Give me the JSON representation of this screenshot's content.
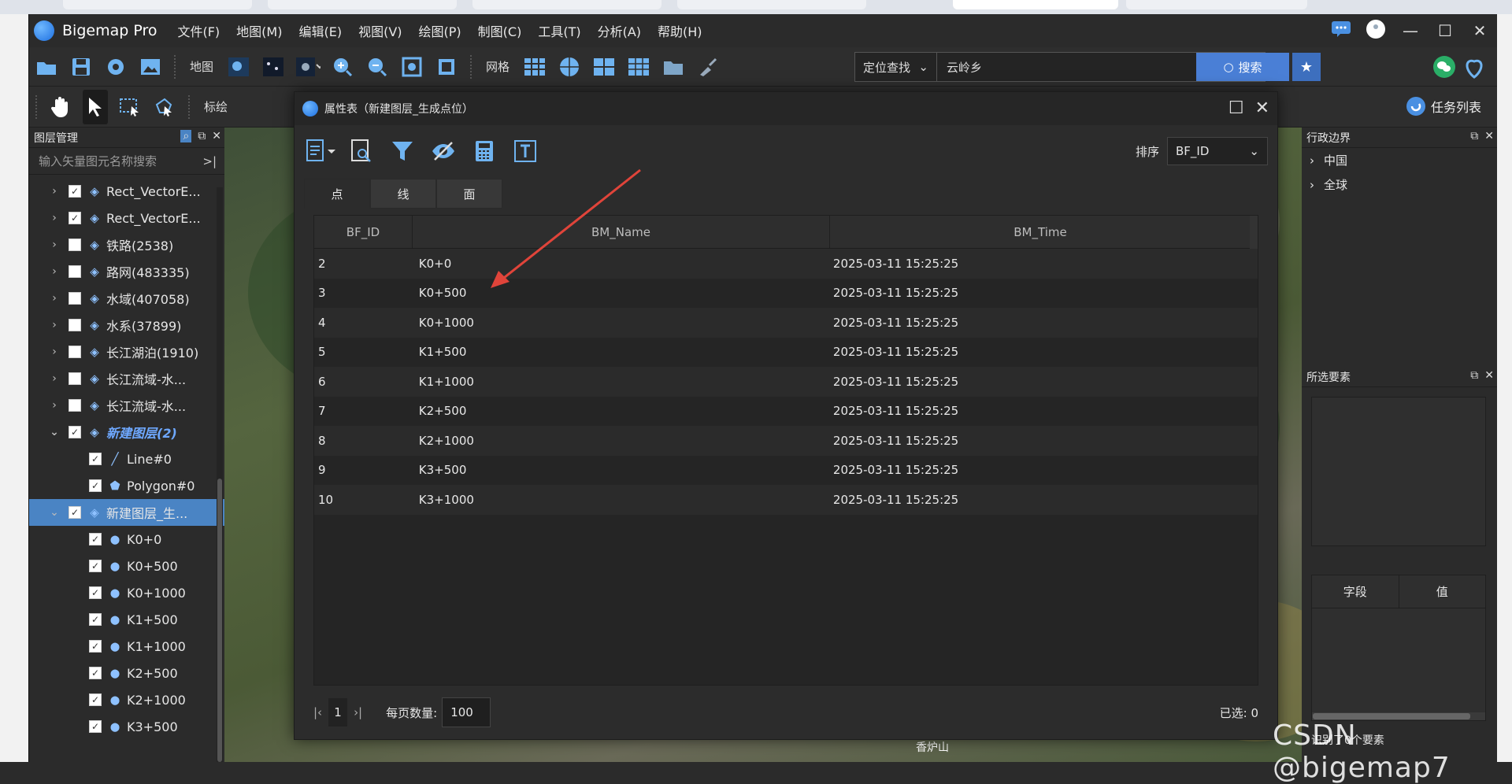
{
  "app": {
    "title": "Bigemap Pro"
  },
  "menu": [
    "文件(F)",
    "地图(M)",
    "编辑(E)",
    "视图(V)",
    "绘图(P)",
    "制图(C)",
    "工具(T)",
    "分析(A)",
    "帮助(H)"
  ],
  "toolbar1": {
    "map_label": "地图",
    "grid_label": "网格",
    "search_mode": "定位查找",
    "search_value": "云岭乡",
    "search_button": "搜索"
  },
  "toolbar2": {
    "annotate_label": "标绘",
    "task_list": "任务列表"
  },
  "left_panel": {
    "title": "图层管理",
    "search_placeholder": "输入矢量图元名称搜索",
    "layers": [
      {
        "label": "Rect_VectorE...",
        "checked": true,
        "expandable": true,
        "style": "normal",
        "indent": 0
      },
      {
        "label": "Rect_VectorE...",
        "checked": true,
        "expandable": true,
        "style": "normal",
        "indent": 0
      },
      {
        "label": "铁路(2538)",
        "checked": false,
        "expandable": true,
        "style": "normal",
        "indent": 0
      },
      {
        "label": "路网(483335)",
        "checked": false,
        "expandable": true,
        "style": "normal",
        "indent": 0
      },
      {
        "label": "水域(407058)",
        "checked": false,
        "expandable": true,
        "style": "normal",
        "indent": 0
      },
      {
        "label": "水系(37899)",
        "checked": false,
        "expandable": true,
        "style": "normal",
        "indent": 0
      },
      {
        "label": "长江湖泊(1910)",
        "checked": false,
        "expandable": true,
        "style": "normal",
        "indent": 0
      },
      {
        "label": "长江流域-水...",
        "checked": false,
        "expandable": true,
        "style": "normal",
        "indent": 0
      },
      {
        "label": "长江流域-水...",
        "checked": false,
        "expandable": true,
        "style": "normal",
        "indent": 0
      },
      {
        "label": "新建图层(2)",
        "checked": true,
        "expandable": true,
        "expanded": true,
        "style": "italic-blue",
        "indent": 0
      },
      {
        "label": "Line#0",
        "checked": true,
        "icon": "line",
        "indent": 1
      },
      {
        "label": "Polygon#0",
        "checked": true,
        "icon": "polygon",
        "indent": 1
      },
      {
        "label": "新建图层_生...",
        "checked": true,
        "expandable": true,
        "expanded": true,
        "style": "selected",
        "indent": 0
      },
      {
        "label": "K0+0",
        "checked": true,
        "icon": "point",
        "indent": 1
      },
      {
        "label": "K0+500",
        "checked": true,
        "icon": "point",
        "indent": 1
      },
      {
        "label": "K0+1000",
        "checked": true,
        "icon": "point",
        "indent": 1
      },
      {
        "label": "K1+500",
        "checked": true,
        "icon": "point",
        "indent": 1
      },
      {
        "label": "K1+1000",
        "checked": true,
        "icon": "point",
        "indent": 1
      },
      {
        "label": "K2+500",
        "checked": true,
        "icon": "point",
        "indent": 1
      },
      {
        "label": "K2+1000",
        "checked": true,
        "icon": "point",
        "indent": 1
      },
      {
        "label": "K3+500",
        "checked": true,
        "icon": "point",
        "indent": 1
      }
    ]
  },
  "right_panel": {
    "admin_title": "行政边界",
    "admin_items": [
      "中国",
      "全球"
    ],
    "selected_title": "所选要素",
    "field_col": "字段",
    "value_col": "值",
    "status": "识别了0个要素"
  },
  "dialog": {
    "title": "属性表（新建图层_生成点位）",
    "sort_label": "排序",
    "sort_value": "BF_ID",
    "tabs": [
      "点",
      "线",
      "面"
    ],
    "columns": [
      "BF_ID",
      "BM_Name",
      "BM_Time"
    ],
    "rows": [
      [
        "2",
        "K0+0",
        "2025-03-11 15:25:25"
      ],
      [
        "3",
        "K0+500",
        "2025-03-11 15:25:25"
      ],
      [
        "4",
        "K0+1000",
        "2025-03-11 15:25:25"
      ],
      [
        "5",
        "K1+500",
        "2025-03-11 15:25:25"
      ],
      [
        "6",
        "K1+1000",
        "2025-03-11 15:25:25"
      ],
      [
        "7",
        "K2+500",
        "2025-03-11 15:25:25"
      ],
      [
        "8",
        "K2+1000",
        "2025-03-11 15:25:25"
      ],
      [
        "9",
        "K3+500",
        "2025-03-11 15:25:25"
      ],
      [
        "10",
        "K3+1000",
        "2025-03-11 15:25:25"
      ]
    ],
    "page": "1",
    "per_page_label": "每页数量:",
    "per_page_value": "100",
    "selected_label": "已选: 0"
  },
  "map": {
    "place_label": "香炉山"
  },
  "watermark": "CSDN @bigemap7",
  "colors": {
    "accent": "#4a84c4",
    "annotation_arrow": "#e0443a",
    "search_button": "#4a7fd6"
  }
}
